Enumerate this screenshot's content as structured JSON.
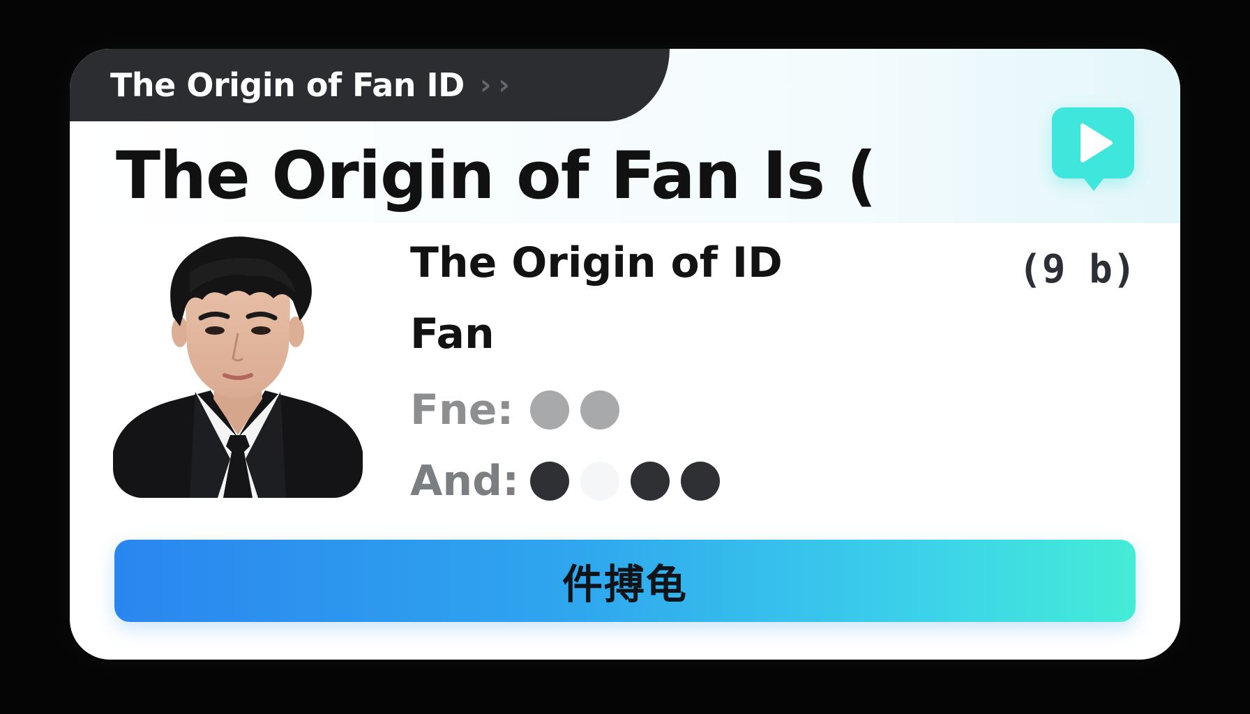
{
  "breadcrumb": {
    "label": "The Origin of Fan ID",
    "chevrons": "› ›"
  },
  "headline": "The Origin of Fan Is (",
  "play_button": {
    "icon": "play-icon",
    "color": "#3ee6dc"
  },
  "profile": {
    "photo_alt": "portrait-photo",
    "title": "The Origin of ID",
    "subtitle": "Fan",
    "meta": "(9 b)"
  },
  "ratings": [
    {
      "label": "Fne:",
      "dots": [
        "light",
        "light"
      ]
    },
    {
      "label": "And:",
      "dots": [
        "dark",
        "empty",
        "dark",
        "dark"
      ]
    }
  ],
  "cta": {
    "label": "件搏龟"
  },
  "colors": {
    "accent_teal": "#3ee6dc",
    "cta_gradient_start": "#2a86ef",
    "cta_gradient_end": "#44ecd6",
    "tab_dark": "#2b2d31"
  }
}
